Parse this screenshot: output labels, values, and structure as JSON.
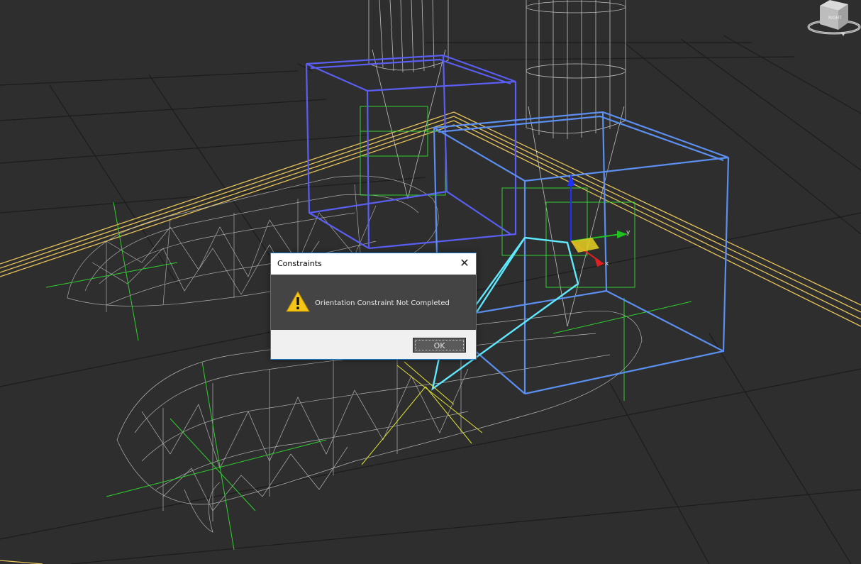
{
  "viewport": {
    "background": "#2e2e2e",
    "grid_color": "#1a1a1a",
    "foot_mesh_color": "#c8c8c8",
    "bone_box_colors": [
      "#5a5ef2",
      "#5b8ff0"
    ],
    "helper_color": "#2fd02f",
    "selection_color": "#60e8ff",
    "ground_line_color": "#e6c35a"
  },
  "viewcube": {
    "face_label": "RIGHT",
    "icon": "viewcube-icon"
  },
  "gizmo": {
    "y_label": "y",
    "x_label": "x"
  },
  "dialog": {
    "title": "Constraints",
    "close_symbol": "✕",
    "icon": "warning-icon",
    "message": "Orientation Constraint Not Completed",
    "ok_label": "OK",
    "accent": "#1883d7"
  }
}
